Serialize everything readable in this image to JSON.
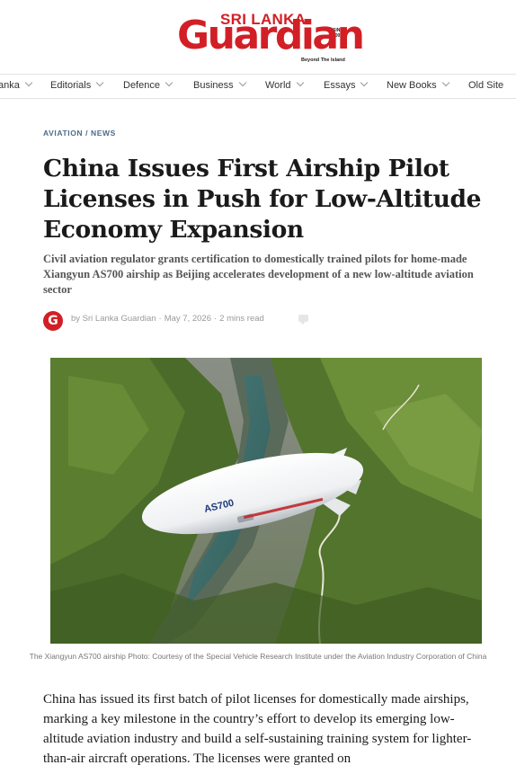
{
  "masthead": {
    "logo_top": "SRI LANKA",
    "logo_main": "Guardian",
    "logo_since": "SINCE 2007",
    "logo_tagline": "Beyond The Island"
  },
  "nav": {
    "items": [
      {
        "label": "anka"
      },
      {
        "label": "Editorials"
      },
      {
        "label": "Defence"
      },
      {
        "label": "Business"
      },
      {
        "label": "World"
      },
      {
        "label": "Essays"
      },
      {
        "label": "New Books"
      },
      {
        "label": "Old Site"
      }
    ]
  },
  "article": {
    "category": "AVIATION / NEWS",
    "title": "China Issues First Airship Pilot Licenses in Push for Low-Altitude Economy Expansion",
    "dek": "Civil aviation regulator grants certification to domestically trained pilots for home-made Xiangyun AS700 airship as Beijing accelerates development of a new low-altitude aviation sector",
    "author": "by Sri Lanka Guardian",
    "date": "May 7, 2026",
    "read_time": "2 mins read",
    "avatar_letter": "G",
    "photo_airship_label": "AS700",
    "caption": "The Xiangyun AS700 airship Photo: Courtesy of the Special Vehicle Research Institute under the Aviation Industry Corporation of China",
    "body": "China has issued its first batch of pilot licenses for domestically made airships, marking a key milestone in the country’s effort to develop its emerging low-altitude aviation industry and build a self-sustaining training system for lighter-than-air aircraft operations. The licenses were granted on"
  },
  "colors": {
    "brand_red": "#d21f26",
    "category_blue": "#4c6a8c",
    "meta_gray": "#9a9a9a"
  }
}
